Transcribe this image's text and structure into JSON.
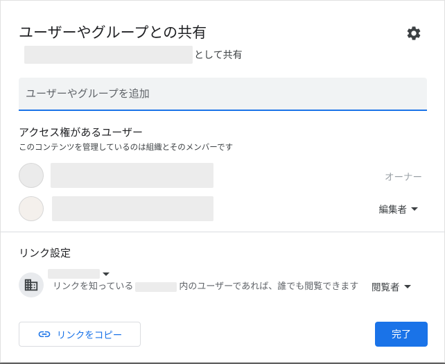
{
  "dialog": {
    "title": "ユーザーやグループとの共有",
    "shared_as_label": "として共有",
    "settings_icon": "gear-icon"
  },
  "add_people": {
    "placeholder": "ユーザーやグループを追加"
  },
  "access": {
    "heading": "アクセス権があるユーザー",
    "subtitle": "このコンテンツを管理しているのは組織とそのメンバーです",
    "people": [
      {
        "role": "オーナー",
        "editable": false
      },
      {
        "role": "編集者",
        "editable": true
      }
    ]
  },
  "link_settings": {
    "heading": "リンク設定",
    "icon": "organization-icon",
    "desc_before": "リンクを知っている",
    "desc_after": "内のユーザーであれば、誰でも閲覧できます",
    "role": "閲覧者"
  },
  "footer": {
    "copy_link_label": "リンクをコピー",
    "copy_icon": "link-icon",
    "done_label": "完了",
    "accent_color": "#1a73e8"
  }
}
